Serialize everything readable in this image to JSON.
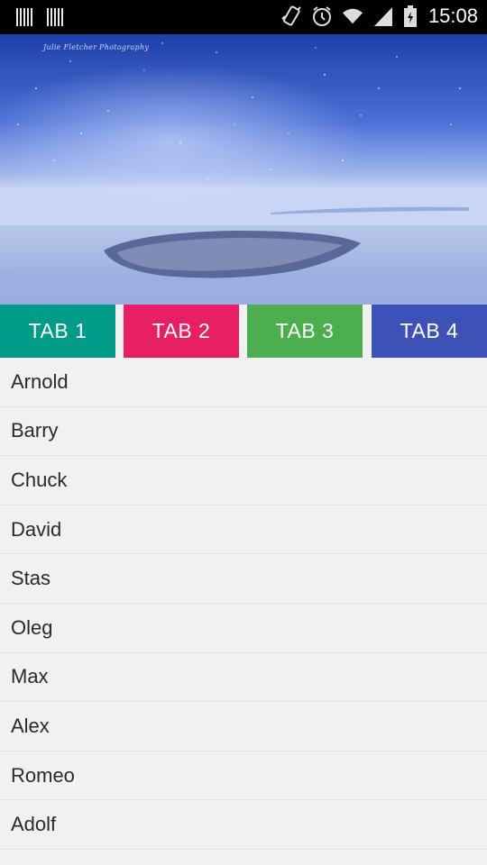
{
  "status_bar": {
    "time": "15:08",
    "icons": [
      "barcode-icon",
      "barcode-icon",
      "vibrate-icon",
      "alarm-icon",
      "wifi-icon",
      "signal-icon",
      "battery-icon"
    ]
  },
  "header_image": {
    "watermark": "Julie Fletcher Photography"
  },
  "tabs": [
    {
      "label": "TAB 1",
      "color": "#009b89"
    },
    {
      "label": "TAB 2",
      "color": "#e91f63"
    },
    {
      "label": "TAB 3",
      "color": "#4cae4f"
    },
    {
      "label": "TAB 4",
      "color": "#3e51b6"
    }
  ],
  "list": {
    "items": [
      "Arnold",
      "Barry",
      "Chuck",
      "David",
      "Stas",
      "Oleg",
      "Max",
      "Alex",
      "Romeo",
      "Adolf"
    ]
  }
}
